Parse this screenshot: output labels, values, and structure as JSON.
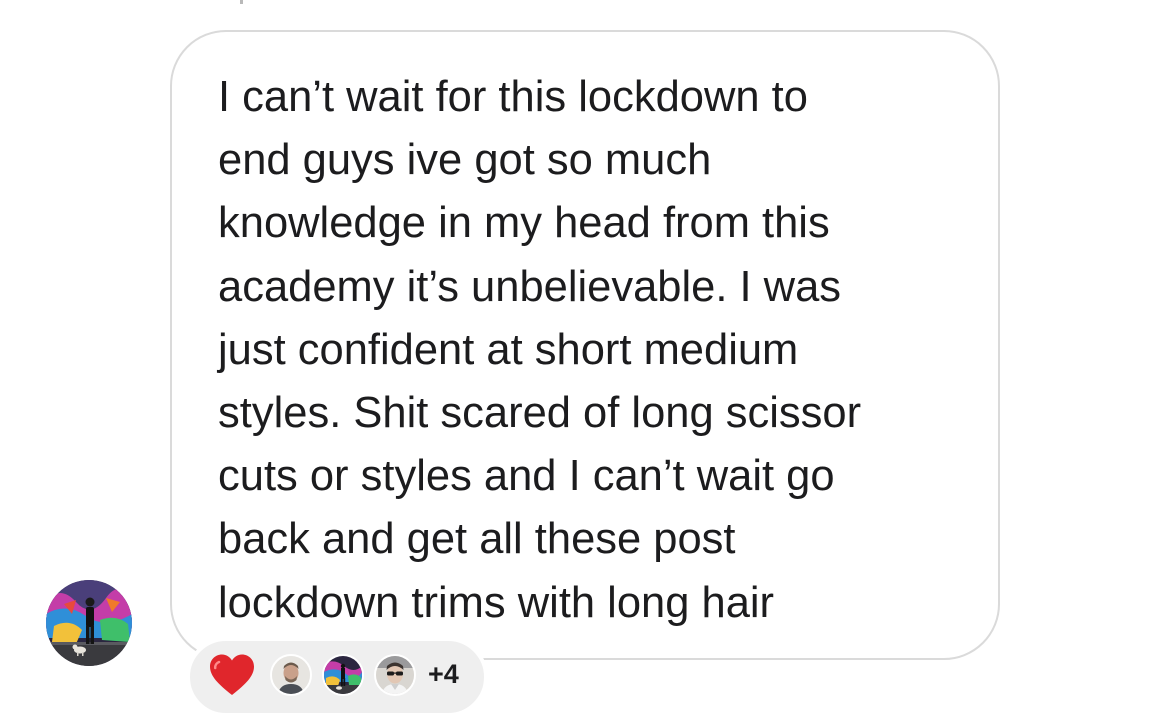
{
  "message": {
    "text": "I can’t wait for this lockdown to\nend guys ive got so much\nknowledge in my head from this\nacademy it’s unbelievable. I was\njust confident at short medium\nstyles. Shit scared of long scissor\ncuts or styles and I can’t wait go\nback and get all these post\nlockdown trims with long hair"
  },
  "sender": {
    "avatar_icon": "sender-avatar-graffiti-photo"
  },
  "reactions": {
    "heart_icon": "red-heart-icon",
    "reactor_avatars": [
      "reactor-avatar-man",
      "reactor-avatar-graffiti",
      "reactor-avatar-sunglasses"
    ],
    "extra_count": "+4"
  },
  "colors": {
    "bubble_border": "#dadada",
    "text": "#1c1c1e",
    "pill_background": "#efefef",
    "heart": "#e0262c"
  }
}
